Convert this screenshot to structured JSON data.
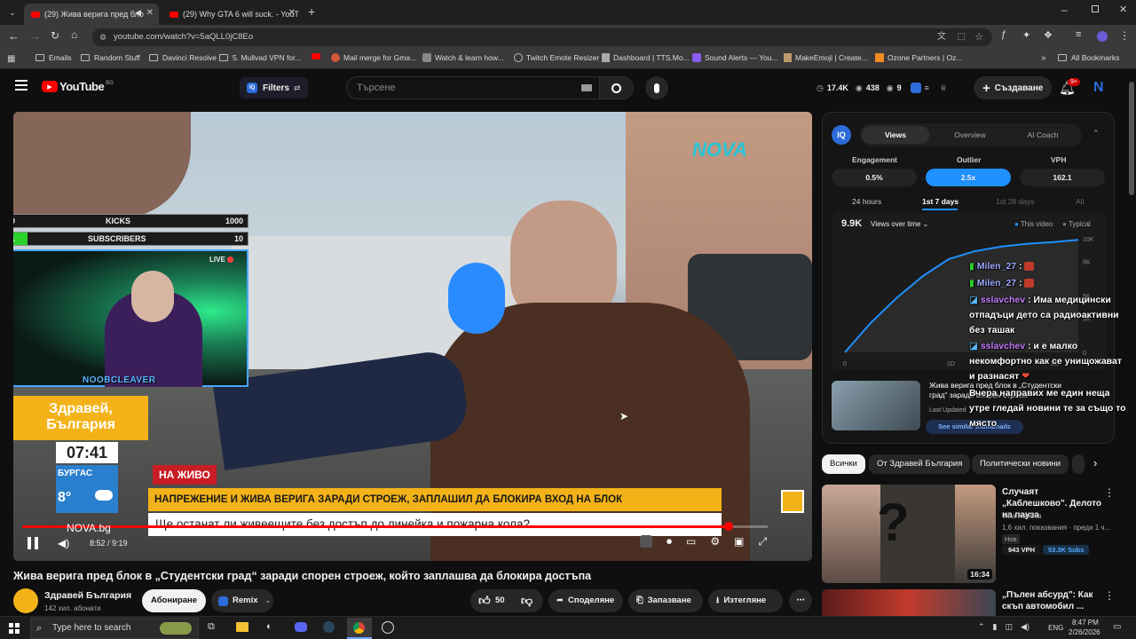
{
  "browser": {
    "tabs": [
      {
        "label": "(29) Жива верига пред бло"
      },
      {
        "label": "(29) Why GTA 6 will suck. - YouT"
      }
    ],
    "url": "youtube.com/watch?v=5aQLL0jC8Eo",
    "bookmarks": [
      "Emails",
      "Random Stuff",
      "Davinci Resolve",
      "5. Mullvad VPN for...",
      "Mail merge for Gma...",
      "Watch & learn how...",
      "Twitch Emote Resizer",
      "Dashboard | TTS.Mo...",
      "Sound Alerts — You...",
      "MakeEmoji | Create...",
      "Ozone Partners | Oz...",
      "All Bookmarks"
    ]
  },
  "yt": {
    "logo": "YouTube",
    "country": "BG",
    "filters": "Filters",
    "search_placeholder": "Търсене",
    "stats": {
      "views": "17.4K",
      "likes": "438",
      "count": "9"
    },
    "create": "Създаване",
    "notif_count": "9+"
  },
  "video": {
    "kicks_value": "0",
    "kicks_label": "KICKS",
    "kicks_goal": "1000",
    "subs_value": "1",
    "subs_label": "SUBSCRIBERS",
    "subs_goal": "10",
    "live_badge": "LIVE",
    "streamer": "NOOBCLEAVER",
    "nova": "NOVA",
    "show_title": "Здравей, България",
    "clock": "07:41",
    "city": "БУРГАС",
    "temp": "8°",
    "live_tag": "НА ЖИВО",
    "headline": "НАПРЕЖЕНИЕ И ЖИВА ВЕРИГА ЗАРАДИ СТРОЕЖ, ЗАПЛАШИЛ ДА БЛОКИРА ВХОД НА БЛОК",
    "subline": "Ще останат ли живеещите без достъп до линейка и пожарна кола?",
    "site": "NOVA.bg",
    "time": "8:52 / 9:19",
    "progress": 0.948,
    "title": "Жива верига пред блок в „Студентски град“ заради спорен строеж, който заплашва да блокира достъпа"
  },
  "channel": {
    "name": "Здравей България",
    "subs": "142 хил. абонати",
    "subscribe": "Абониране",
    "remix": "Remix"
  },
  "actions": {
    "likes": "50",
    "share": "Споделяне",
    "save": "Запазване",
    "download": "Изтегляне"
  },
  "panel": {
    "logo": "IQ",
    "tabs": [
      "Views",
      "Overview",
      "AI Coach"
    ],
    "metric_labels": [
      "Engagement",
      "Outlier",
      "VPH"
    ],
    "metric_values": [
      "0.5%",
      "2.5x",
      "162.1"
    ],
    "ranges": [
      "24 hours",
      "1st 7 days",
      "1st 28 days",
      "All"
    ],
    "views_total": "9.9K",
    "views_dropdown": "Views over time",
    "legend": [
      "This video",
      "Typical"
    ],
    "y_ticks": [
      "10K",
      "8K",
      "5K",
      "3K",
      "0"
    ],
    "x_ticks": [
      "0",
      "1D",
      "2D"
    ],
    "similar_title": "Жива верига пред блок в „Студентски град“ заради спорен строеж",
    "last_updated": "Last Updated",
    "similar_btn": "See similar thumbnails"
  },
  "chart_data": {
    "type": "line",
    "title": "",
    "series": [
      {
        "name": "This video",
        "x": [
          0,
          0.25,
          0.5,
          0.75,
          1,
          1.25,
          1.5,
          1.75,
          2,
          2.25
        ],
        "y": [
          0,
          2600,
          4800,
          6700,
          8200,
          8900,
          9300,
          9550,
          9700,
          9900
        ]
      }
    ],
    "xlabel": "",
    "ylabel": "",
    "ylim": [
      0,
      10000
    ]
  },
  "chat": [
    {
      "name": "Milen_27",
      "text": ""
    },
    {
      "name": "Milen_27",
      "text": ""
    },
    {
      "name": "sslavchev",
      "text": "Има медицински отпадъци дето са радиоактивни без ташак"
    },
    {
      "name": "sslavchev",
      "text": "и е малко некомфортно как се унищожават и разнасят"
    },
    {
      "name": "",
      "text": "Вчера направих ме един неща утре гледай новини те за също то място"
    }
  ],
  "chips": [
    "Всички",
    "От Здравей България",
    "Политически новини"
  ],
  "recs": [
    {
      "title": "Случаят „Каблешково\". Делото на пауза",
      "channel": "Tina Ivailova",
      "meta": "1,6 хил. показвания · преди 1 ч...",
      "badge": "Нов",
      "vph": "943 VPH",
      "subs": "53.3K Subs",
      "duration": "16:34"
    },
    {
      "title": "„Пълен абсурд\": Как скъп автомобил ..."
    }
  ],
  "taskbar": {
    "search": "Type here to search",
    "lang": "ENG",
    "time": "8:47 PM",
    "date": "2/26/2026"
  }
}
